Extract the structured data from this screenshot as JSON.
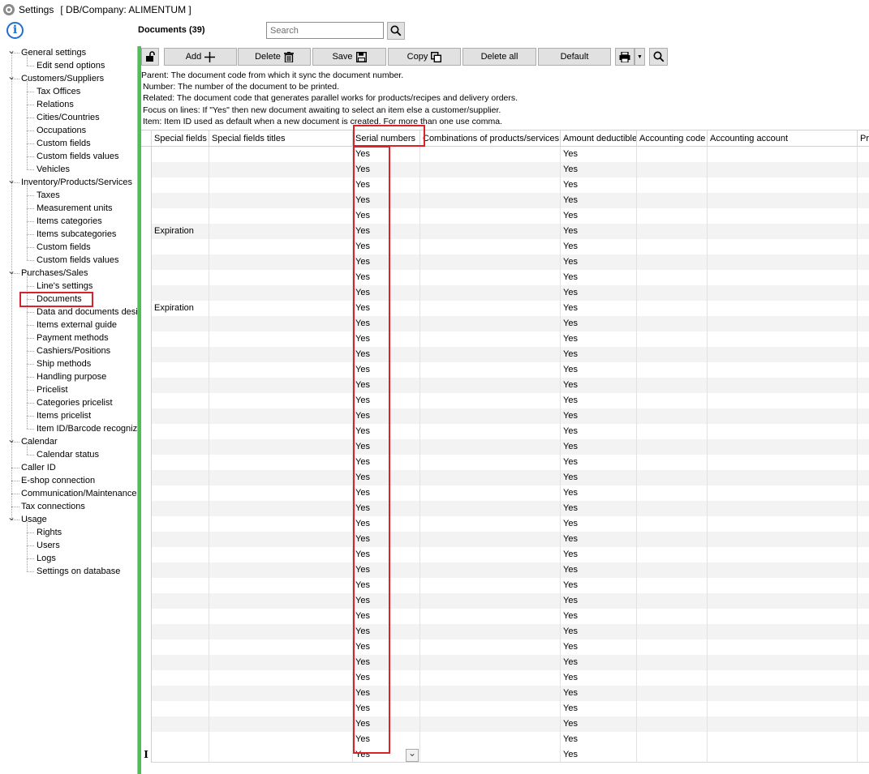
{
  "window": {
    "title": "Settings",
    "subtitle": "[ DB/Company: ALIMENTUM ]"
  },
  "info_glyph": "i",
  "tree": [
    {
      "label": "General settings",
      "level": 0,
      "expanded": true
    },
    {
      "label": "Edit send options",
      "level": 1
    },
    {
      "label": "Customers/Suppliers",
      "level": 0,
      "expanded": true
    },
    {
      "label": "Tax Offices",
      "level": 1
    },
    {
      "label": "Relations",
      "level": 1
    },
    {
      "label": "Cities/Countries",
      "level": 1
    },
    {
      "label": "Occupations",
      "level": 1
    },
    {
      "label": "Custom fields",
      "level": 1
    },
    {
      "label": "Custom fields values",
      "level": 1
    },
    {
      "label": "Vehicles",
      "level": 1
    },
    {
      "label": "Inventory/Products/Services",
      "level": 0,
      "expanded": true
    },
    {
      "label": "Taxes",
      "level": 1
    },
    {
      "label": "Measurement units",
      "level": 1
    },
    {
      "label": "Items categories",
      "level": 1
    },
    {
      "label": "Items subcategories",
      "level": 1
    },
    {
      "label": "Custom fields",
      "level": 1
    },
    {
      "label": "Custom fields values",
      "level": 1
    },
    {
      "label": "Purchases/Sales",
      "level": 0,
      "expanded": true
    },
    {
      "label": "Line's settings",
      "level": 1
    },
    {
      "label": "Documents",
      "level": 1,
      "selected": true
    },
    {
      "label": "Data and documents desi",
      "level": 1
    },
    {
      "label": "Items external guide",
      "level": 1
    },
    {
      "label": "Payment methods",
      "level": 1
    },
    {
      "label": "Cashiers/Positions",
      "level": 1
    },
    {
      "label": "Ship methods",
      "level": 1
    },
    {
      "label": "Handling purpose",
      "level": 1
    },
    {
      "label": "Pricelist",
      "level": 1
    },
    {
      "label": "Categories pricelist",
      "level": 1
    },
    {
      "label": "Items pricelist",
      "level": 1
    },
    {
      "label": "Item ID/Barcode recognize",
      "level": 1
    },
    {
      "label": "Calendar",
      "level": 0,
      "expanded": true
    },
    {
      "label": "Calendar status",
      "level": 1
    },
    {
      "label": "Caller ID",
      "level": 0
    },
    {
      "label": "E-shop connection",
      "level": 0
    },
    {
      "label": "Communication/Maintenance",
      "level": 0
    },
    {
      "label": "Tax connections",
      "level": 0
    },
    {
      "label": "Usage",
      "level": 0,
      "expanded": true
    },
    {
      "label": "Rights",
      "level": 1
    },
    {
      "label": "Users",
      "level": 1
    },
    {
      "label": "Logs",
      "level": 1
    },
    {
      "label": "Settings on database",
      "level": 1
    }
  ],
  "header": {
    "title": "Documents (39)",
    "search_placeholder": "Search"
  },
  "toolbar": {
    "add": "Add",
    "delete": "Delete",
    "save": "Save",
    "copy": "Copy",
    "delete_all": "Delete all",
    "default": "Default"
  },
  "help_lines": [
    "Parent: The document code from which it sync the document number.",
    "Number: The number of the document to be printed.",
    "Related: The document code that generates parallel works for products/recipes and delivery orders.",
    "Focus on lines: If \"Yes\" then new document awaiting to select an item else a customer/supplier.",
    "Item: Item ID used as default when a new document is created. For more than one use comma."
  ],
  "grid": {
    "columns": [
      "Special fields",
      "Special fields titles",
      "Serial numbers",
      "Combinations of products/services",
      "Amount deductible",
      "Accounting code",
      "Accounting account",
      "Pri"
    ],
    "rows": [
      [
        "",
        "",
        "Yes",
        "",
        "Yes",
        "",
        "",
        ""
      ],
      [
        "",
        "",
        "Yes",
        "",
        "Yes",
        "",
        "",
        ""
      ],
      [
        "",
        "",
        "Yes",
        "",
        "Yes",
        "",
        "",
        ""
      ],
      [
        "",
        "",
        "Yes",
        "",
        "Yes",
        "",
        "",
        ""
      ],
      [
        "",
        "",
        "Yes",
        "",
        "Yes",
        "",
        "",
        ""
      ],
      [
        "Expiration",
        "",
        "Yes",
        "",
        "Yes",
        "",
        "",
        ""
      ],
      [
        "",
        "",
        "Yes",
        "",
        "Yes",
        "",
        "",
        ""
      ],
      [
        "",
        "",
        "Yes",
        "",
        "Yes",
        "",
        "",
        ""
      ],
      [
        "",
        "",
        "Yes",
        "",
        "Yes",
        "",
        "",
        ""
      ],
      [
        "",
        "",
        "Yes",
        "",
        "Yes",
        "",
        "",
        ""
      ],
      [
        "Expiration",
        "",
        "Yes",
        "",
        "Yes",
        "",
        "",
        ""
      ],
      [
        "",
        "",
        "Yes",
        "",
        "Yes",
        "",
        "",
        ""
      ],
      [
        "",
        "",
        "Yes",
        "",
        "Yes",
        "",
        "",
        ""
      ],
      [
        "",
        "",
        "Yes",
        "",
        "Yes",
        "",
        "",
        ""
      ],
      [
        "",
        "",
        "Yes",
        "",
        "Yes",
        "",
        "",
        ""
      ],
      [
        "",
        "",
        "Yes",
        "",
        "Yes",
        "",
        "",
        ""
      ],
      [
        "",
        "",
        "Yes",
        "",
        "Yes",
        "",
        "",
        ""
      ],
      [
        "",
        "",
        "Yes",
        "",
        "Yes",
        "",
        "",
        ""
      ],
      [
        "",
        "",
        "Yes",
        "",
        "Yes",
        "",
        "",
        ""
      ],
      [
        "",
        "",
        "Yes",
        "",
        "Yes",
        "",
        "",
        ""
      ],
      [
        "",
        "",
        "Yes",
        "",
        "Yes",
        "",
        "",
        ""
      ],
      [
        "",
        "",
        "Yes",
        "",
        "Yes",
        "",
        "",
        ""
      ],
      [
        "",
        "",
        "Yes",
        "",
        "Yes",
        "",
        "",
        ""
      ],
      [
        "",
        "",
        "Yes",
        "",
        "Yes",
        "",
        "",
        ""
      ],
      [
        "",
        "",
        "Yes",
        "",
        "Yes",
        "",
        "",
        ""
      ],
      [
        "",
        "",
        "Yes",
        "",
        "Yes",
        "",
        "",
        ""
      ],
      [
        "",
        "",
        "Yes",
        "",
        "Yes",
        "",
        "",
        ""
      ],
      [
        "",
        "",
        "Yes",
        "",
        "Yes",
        "",
        "",
        ""
      ],
      [
        "",
        "",
        "Yes",
        "",
        "Yes",
        "",
        "",
        ""
      ],
      [
        "",
        "",
        "Yes",
        "",
        "Yes",
        "",
        "",
        ""
      ],
      [
        "",
        "",
        "Yes",
        "",
        "Yes",
        "",
        "",
        ""
      ],
      [
        "",
        "",
        "Yes",
        "",
        "Yes",
        "",
        "",
        ""
      ],
      [
        "",
        "",
        "Yes",
        "",
        "Yes",
        "",
        "",
        ""
      ],
      [
        "",
        "",
        "Yes",
        "",
        "Yes",
        "",
        "",
        ""
      ],
      [
        "",
        "",
        "Yes",
        "",
        "Yes",
        "",
        "",
        ""
      ],
      [
        "",
        "",
        "Yes",
        "",
        "Yes",
        "",
        "",
        ""
      ],
      [
        "",
        "",
        "Yes",
        "",
        "Yes",
        "",
        "",
        ""
      ],
      [
        "",
        "",
        "Yes",
        "",
        "Yes",
        "",
        "",
        ""
      ],
      [
        "",
        "",
        "Yes",
        "",
        "Yes",
        "",
        "",
        ""
      ]
    ],
    "edit_row_marker": "I",
    "edit_row_value": "Yes",
    "edit_row_amount": "Yes"
  },
  "colors": {
    "highlight": "#d8232a",
    "accent_green": "#4bc05a",
    "info_blue": "#1e6fd0"
  }
}
